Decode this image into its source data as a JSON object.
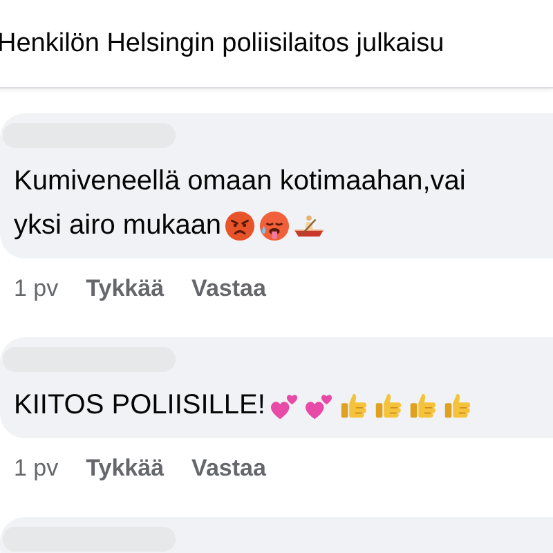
{
  "header": {
    "title": "Henkilön Helsingin poliisilaitos julkaisu"
  },
  "comments": [
    {
      "name_hidden": true,
      "lines": [
        {
          "text": "Kumiveneellä omaan kotimaahan,vai"
        },
        {
          "text": "yksi airo mukaan",
          "emojis": [
            {
              "kind": "angry"
            },
            {
              "kind": "hot"
            },
            {
              "kind": "rowboat"
            }
          ]
        }
      ],
      "time": "1 pv",
      "actions": [
        "Tykkää",
        "Vastaa"
      ]
    },
    {
      "name_hidden": true,
      "lines": [
        {
          "text": "KIITOS POLIISILLE!",
          "emojis": [
            {
              "kind": "hearts"
            },
            {
              "kind": "hearts"
            },
            {
              "kind": "thumb"
            },
            {
              "kind": "thumb"
            },
            {
              "kind": "thumb"
            },
            {
              "kind": "thumb"
            }
          ]
        }
      ],
      "time": "1 pv",
      "actions": [
        "Tykkää",
        "Vastaa"
      ]
    },
    {
      "name_hidden": true
    }
  ]
}
